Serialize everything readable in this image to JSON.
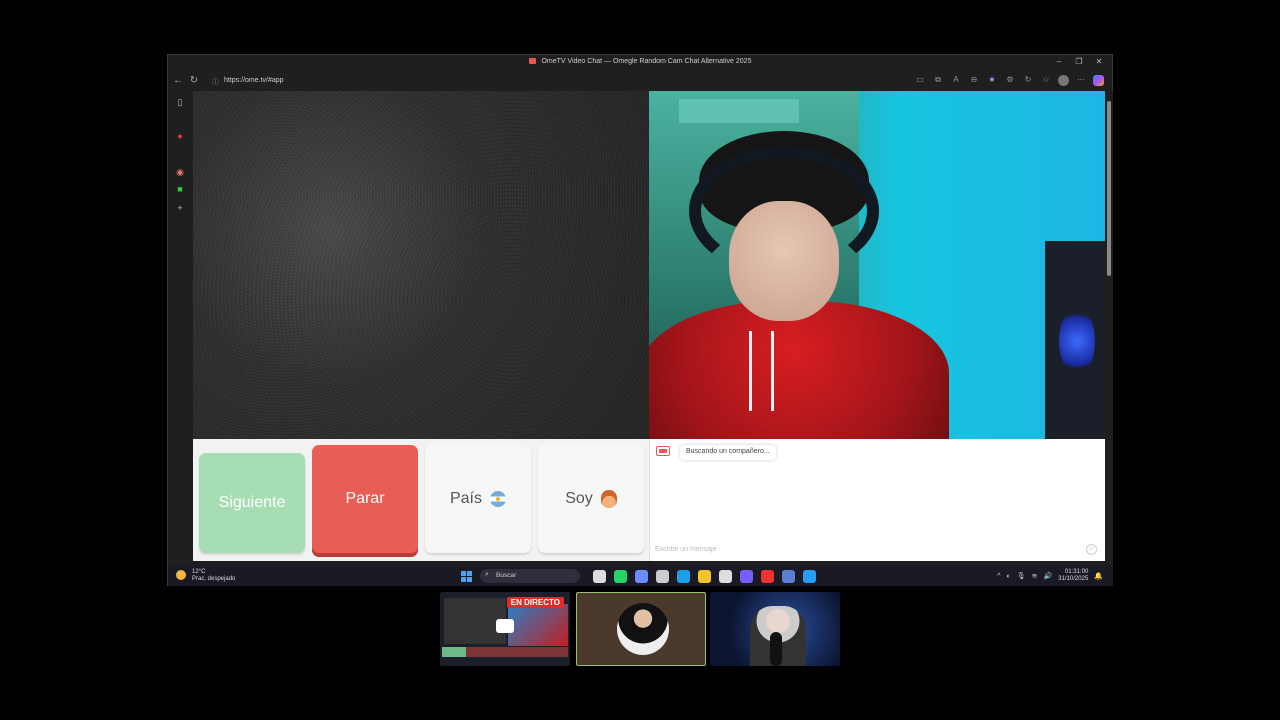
{
  "browser": {
    "window_title": "OmeTV Video Chat — Omegle Random Cam Chat Alternative 2025",
    "url": "https://ome.tv/#app",
    "win_minimize": "–",
    "win_maximize": "❐",
    "win_close": "✕"
  },
  "controls": {
    "next_label": "Siguiente",
    "stop_label": "Parar",
    "country_label": "País",
    "me_label": "Soy"
  },
  "chat": {
    "status": "Buscando un compañero...",
    "input_placeholder": "Escribe un mensaje"
  },
  "taskbar": {
    "weather_temp": "12°C",
    "weather_desc": "Prac. despejado",
    "search_label": "Buscar",
    "time": "01:31:00",
    "date": "31/10/2025"
  },
  "overlay": {
    "live_badge": "EN DIRECTO"
  },
  "colors": {
    "next_button": "#a6ddb3",
    "stop_button": "#e65e55",
    "live_badge": "#e22a2a"
  }
}
